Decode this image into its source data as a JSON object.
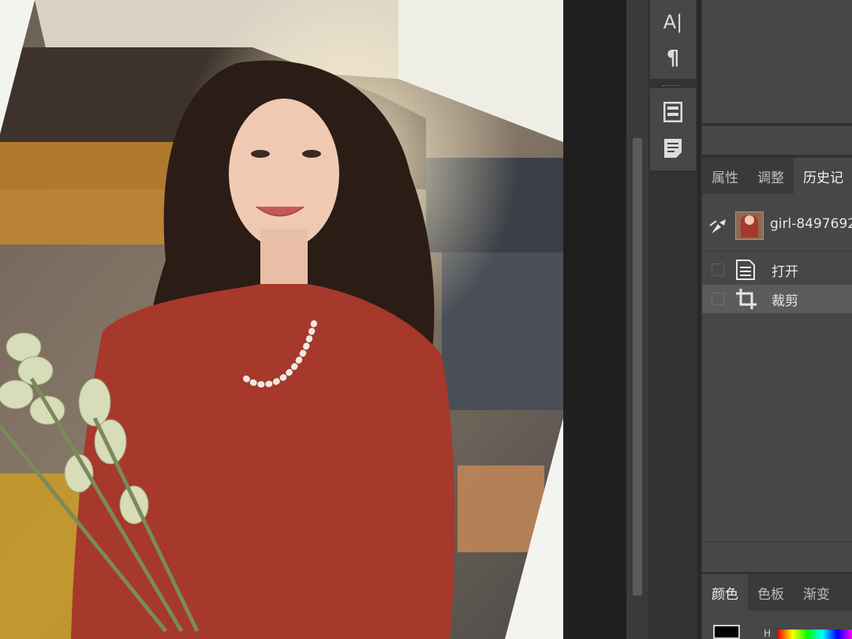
{
  "canvas": {
    "image_name": "girl-8497692"
  },
  "tools": {
    "items": [
      {
        "name": "character-panel-icon",
        "glyph": "A|"
      },
      {
        "name": "paragraph-panel-icon",
        "glyph": "¶"
      },
      {
        "name": "layout-panel-icon",
        "glyph": ""
      },
      {
        "name": "notes-panel-icon",
        "glyph": ""
      }
    ]
  },
  "history_panel": {
    "tabs": [
      "属性",
      "调整",
      "历史记"
    ],
    "active_tab": "历史记",
    "snapshot_name": "girl-8497692",
    "states": [
      {
        "label": "打开",
        "icon": "document-icon",
        "selected": false
      },
      {
        "label": "裁剪",
        "icon": "crop-icon",
        "selected": true
      }
    ]
  },
  "color_panel": {
    "tabs": [
      "颜色",
      "色板",
      "渐变"
    ],
    "active_tab": "颜色",
    "fg_color": "#000000",
    "spectrum_label": "H"
  }
}
